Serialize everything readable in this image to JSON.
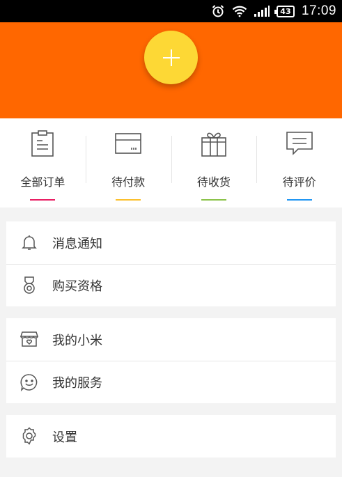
{
  "status_bar": {
    "battery": "43",
    "time": "17:09",
    "icons": [
      "alarm-icon",
      "wifi-icon",
      "signal-icon",
      "battery-icon"
    ]
  },
  "header": {
    "background_color": "#ff6700",
    "add_button_color": "#fdd835",
    "add_button_icon": "plus-icon"
  },
  "orders": [
    {
      "label": "全部订单",
      "icon": "clipboard-icon",
      "accent": "#e91e63"
    },
    {
      "label": "待付款",
      "icon": "card-icon",
      "accent": "#fbc02d"
    },
    {
      "label": "待收货",
      "icon": "gift-icon",
      "accent": "#8bc34a"
    },
    {
      "label": "待评价",
      "icon": "comment-icon",
      "accent": "#2196f3"
    }
  ],
  "menu": {
    "group1": [
      {
        "label": "消息通知",
        "icon": "bell-icon"
      },
      {
        "label": "购买资格",
        "icon": "medal-icon"
      }
    ],
    "group2": [
      {
        "label": "我的小米",
        "icon": "store-icon"
      },
      {
        "label": "我的服务",
        "icon": "smile-icon"
      }
    ],
    "group3": [
      {
        "label": "设置",
        "icon": "settings-icon"
      }
    ]
  }
}
